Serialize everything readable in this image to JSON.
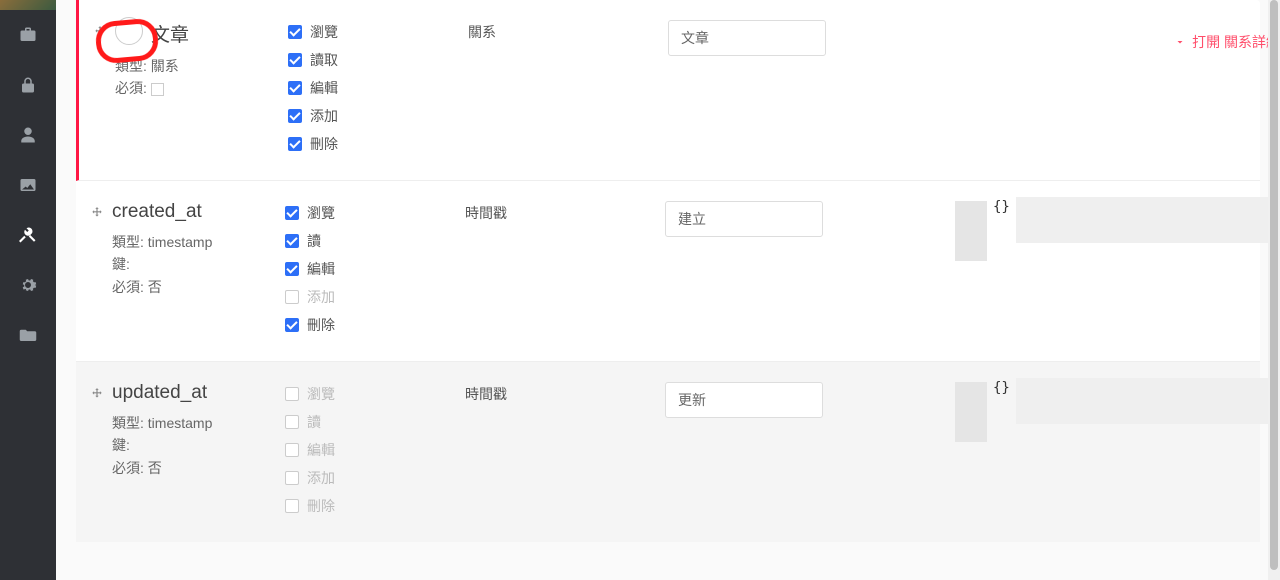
{
  "sidebar": {
    "items": [
      "briefcase",
      "lock",
      "user",
      "image",
      "tools",
      "gear",
      "folder"
    ]
  },
  "rows": [
    {
      "id": "article",
      "name": "文章",
      "meta": {
        "type_label": "類型:",
        "type": "關系",
        "required_label": "必須:",
        "required_value": ""
      },
      "perms": [
        {
          "label": "瀏覽",
          "checked": true
        },
        {
          "label": "讀取",
          "checked": true
        },
        {
          "label": "編輯",
          "checked": true
        },
        {
          "label": "添加",
          "checked": true
        },
        {
          "label": "刪除",
          "checked": true
        }
      ],
      "type_col": "關系",
      "input_value": "文章",
      "expand_label": "打開 關系詳細內容"
    },
    {
      "id": "created_at",
      "name": "created_at",
      "meta": {
        "type_label": "類型:",
        "type": "timestamp",
        "key_label": "鍵:",
        "key": "",
        "required_label": "必須:",
        "required_value": "否"
      },
      "perms": [
        {
          "label": "瀏覽",
          "checked": true
        },
        {
          "label": "讀",
          "checked": true
        },
        {
          "label": "編輯",
          "checked": true
        },
        {
          "label": "添加",
          "checked": false,
          "disabled": true
        },
        {
          "label": "刪除",
          "checked": true
        }
      ],
      "type_col": "時間戳",
      "input_value": "建立",
      "json": "{}"
    },
    {
      "id": "updated_at",
      "name": "updated_at",
      "meta": {
        "type_label": "類型:",
        "type": "timestamp",
        "key_label": "鍵:",
        "key": "",
        "required_label": "必須:",
        "required_value": "否"
      },
      "perms": [
        {
          "label": "瀏覽",
          "checked": false,
          "disabled": true
        },
        {
          "label": "讀",
          "checked": false,
          "disabled": true
        },
        {
          "label": "編輯",
          "checked": false,
          "disabled": true
        },
        {
          "label": "添加",
          "checked": false,
          "disabled": true
        },
        {
          "label": "刪除",
          "checked": false,
          "disabled": true
        }
      ],
      "type_col": "時間戳",
      "input_value": "更新",
      "json": "{}"
    }
  ]
}
